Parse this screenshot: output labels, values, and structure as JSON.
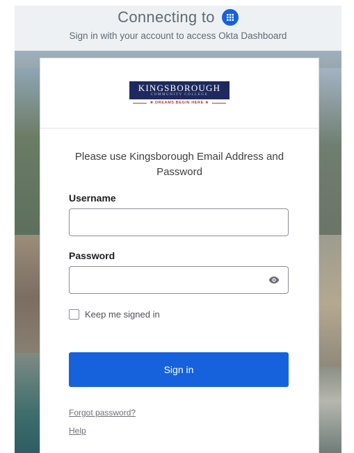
{
  "header": {
    "title": "Connecting to",
    "subtitle": "Sign in with your account to access Okta Dashboard"
  },
  "logo": {
    "name": "KINGSBOROUGH",
    "sub": "COMMUNITY COLLEGE",
    "tagline": "★ DREAMS BEGIN HERE ★"
  },
  "form": {
    "instruction": "Please use Kingsborough Email Address and Password",
    "username_label": "Username",
    "username_value": "",
    "password_label": "Password",
    "password_value": "",
    "remember_label": "Keep me signed in",
    "remember_checked": false,
    "submit_label": "Sign in"
  },
  "links": {
    "forgot": "Forgot password?",
    "help": "Help"
  },
  "colors": {
    "accent": "#1662dd",
    "logo_bg": "#1e2a5e",
    "logo_accent": "#c8312a"
  },
  "icons": {
    "app": "okta-dashboard-icon",
    "password_toggle": "eye-icon"
  }
}
